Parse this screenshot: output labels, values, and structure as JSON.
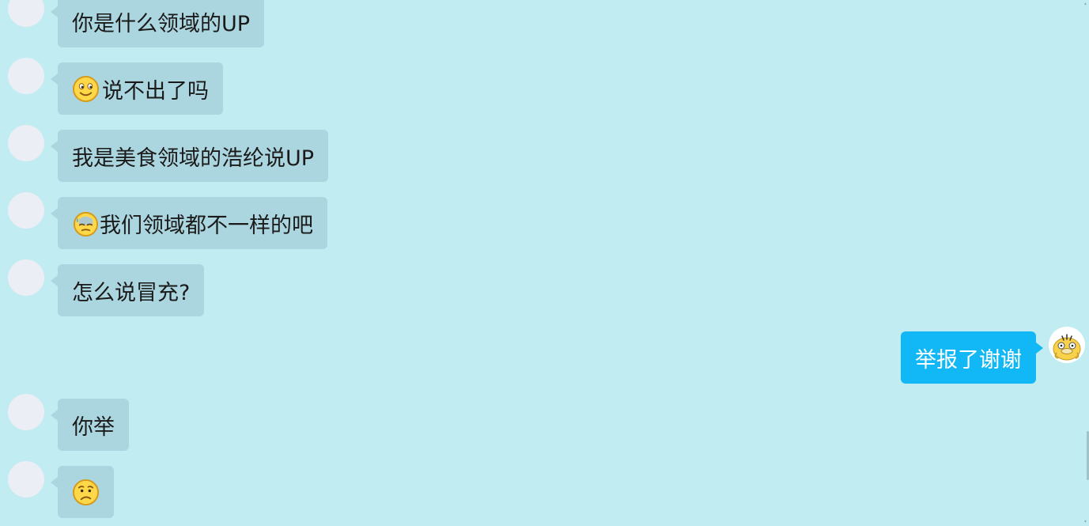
{
  "messages": [
    {
      "text": "你是什么领域的UP",
      "emoji": null
    },
    {
      "text": "说不出了吗",
      "emoji": "smile-emoji"
    },
    {
      "text": "我是美食领域的浩纶说UP",
      "emoji": null
    },
    {
      "text": "我们领域都不一样的吧",
      "emoji": "sweat-emoji"
    },
    {
      "text": "怎么说冒充?",
      "emoji": null
    },
    {
      "text": "举报了谢谢",
      "emoji": null,
      "sender": "self"
    },
    {
      "text": "你举",
      "emoji": null
    },
    {
      "text": "",
      "emoji": "frown-emoji"
    }
  ],
  "colors": {
    "background": "#c0ecf2",
    "incoming_bubble": "#acd6df",
    "outgoing_bubble": "#12b7f5"
  }
}
